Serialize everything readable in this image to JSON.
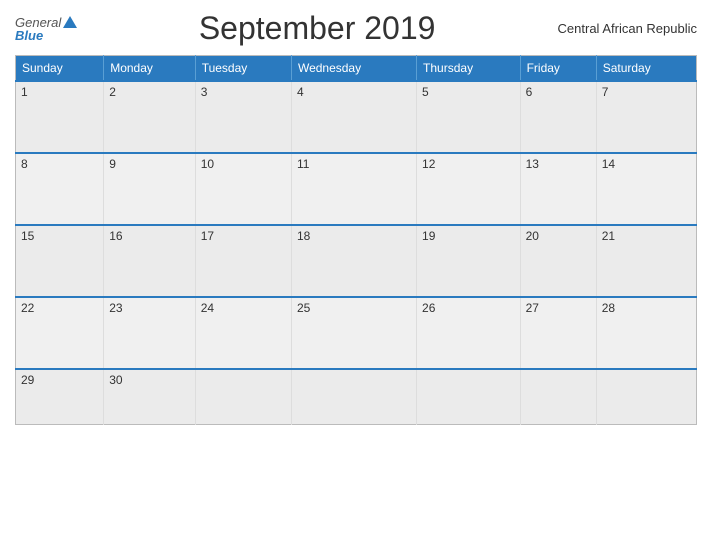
{
  "header": {
    "logo_general": "General",
    "logo_blue": "Blue",
    "title": "September 2019",
    "country": "Central African Republic"
  },
  "weekdays": [
    "Sunday",
    "Monday",
    "Tuesday",
    "Wednesday",
    "Thursday",
    "Friday",
    "Saturday"
  ],
  "weeks": [
    [
      {
        "day": "1"
      },
      {
        "day": "2"
      },
      {
        "day": "3"
      },
      {
        "day": "4"
      },
      {
        "day": "5"
      },
      {
        "day": "6"
      },
      {
        "day": "7"
      }
    ],
    [
      {
        "day": "8"
      },
      {
        "day": "9"
      },
      {
        "day": "10"
      },
      {
        "day": "11"
      },
      {
        "day": "12"
      },
      {
        "day": "13"
      },
      {
        "day": "14"
      }
    ],
    [
      {
        "day": "15"
      },
      {
        "day": "16"
      },
      {
        "day": "17"
      },
      {
        "day": "18"
      },
      {
        "day": "19"
      },
      {
        "day": "20"
      },
      {
        "day": "21"
      }
    ],
    [
      {
        "day": "22"
      },
      {
        "day": "23"
      },
      {
        "day": "24"
      },
      {
        "day": "25"
      },
      {
        "day": "26"
      },
      {
        "day": "27"
      },
      {
        "day": "28"
      }
    ],
    [
      {
        "day": "29"
      },
      {
        "day": "30"
      },
      {
        "day": ""
      },
      {
        "day": ""
      },
      {
        "day": ""
      },
      {
        "day": ""
      },
      {
        "day": ""
      }
    ]
  ]
}
